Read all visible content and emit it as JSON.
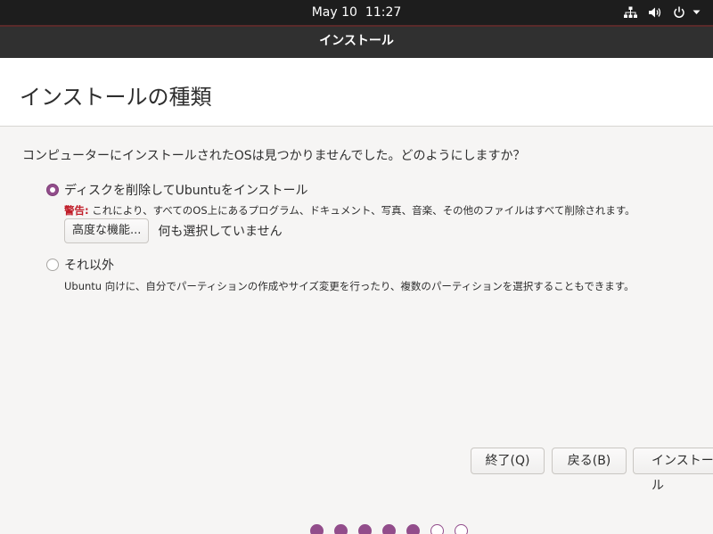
{
  "topbar": {
    "date": "May 10",
    "time": "11:27",
    "icons": [
      "network-icon",
      "volume-icon",
      "power-icon",
      "chevron-down-icon"
    ]
  },
  "window": {
    "title": "インストール"
  },
  "page": {
    "title": "インストールの種類",
    "question": "コンピューターにインストールされたOSは見つかりませんでした。どのようにしますか？"
  },
  "options": {
    "erase": {
      "label": "ディスクを削除してUbuntuをインストール",
      "warning_label": "警告:",
      "warning_text": " これにより、すべてのOS上にあるプログラム、ドキュメント、写真、音楽、その他のファイルはすべて削除されます。",
      "selected": true
    },
    "advanced": {
      "button_label": "高度な機能...",
      "status": "何も選択していません"
    },
    "other": {
      "label": "それ以外",
      "description": "Ubuntu 向けに、自分でパーティションの作成やサイズ変更を行ったり、複数のパーティションを選択することもできます。",
      "selected": false
    }
  },
  "buttons": {
    "quit": "終了(Q)",
    "back": "戻る(B)",
    "install": "インストール"
  },
  "progress": {
    "total_steps": 7,
    "completed_steps": 5
  },
  "colors": {
    "accent": "#924d8b",
    "warning": "#c01c28",
    "topbar": "#1d1d1d",
    "titlebar": "#303030"
  }
}
